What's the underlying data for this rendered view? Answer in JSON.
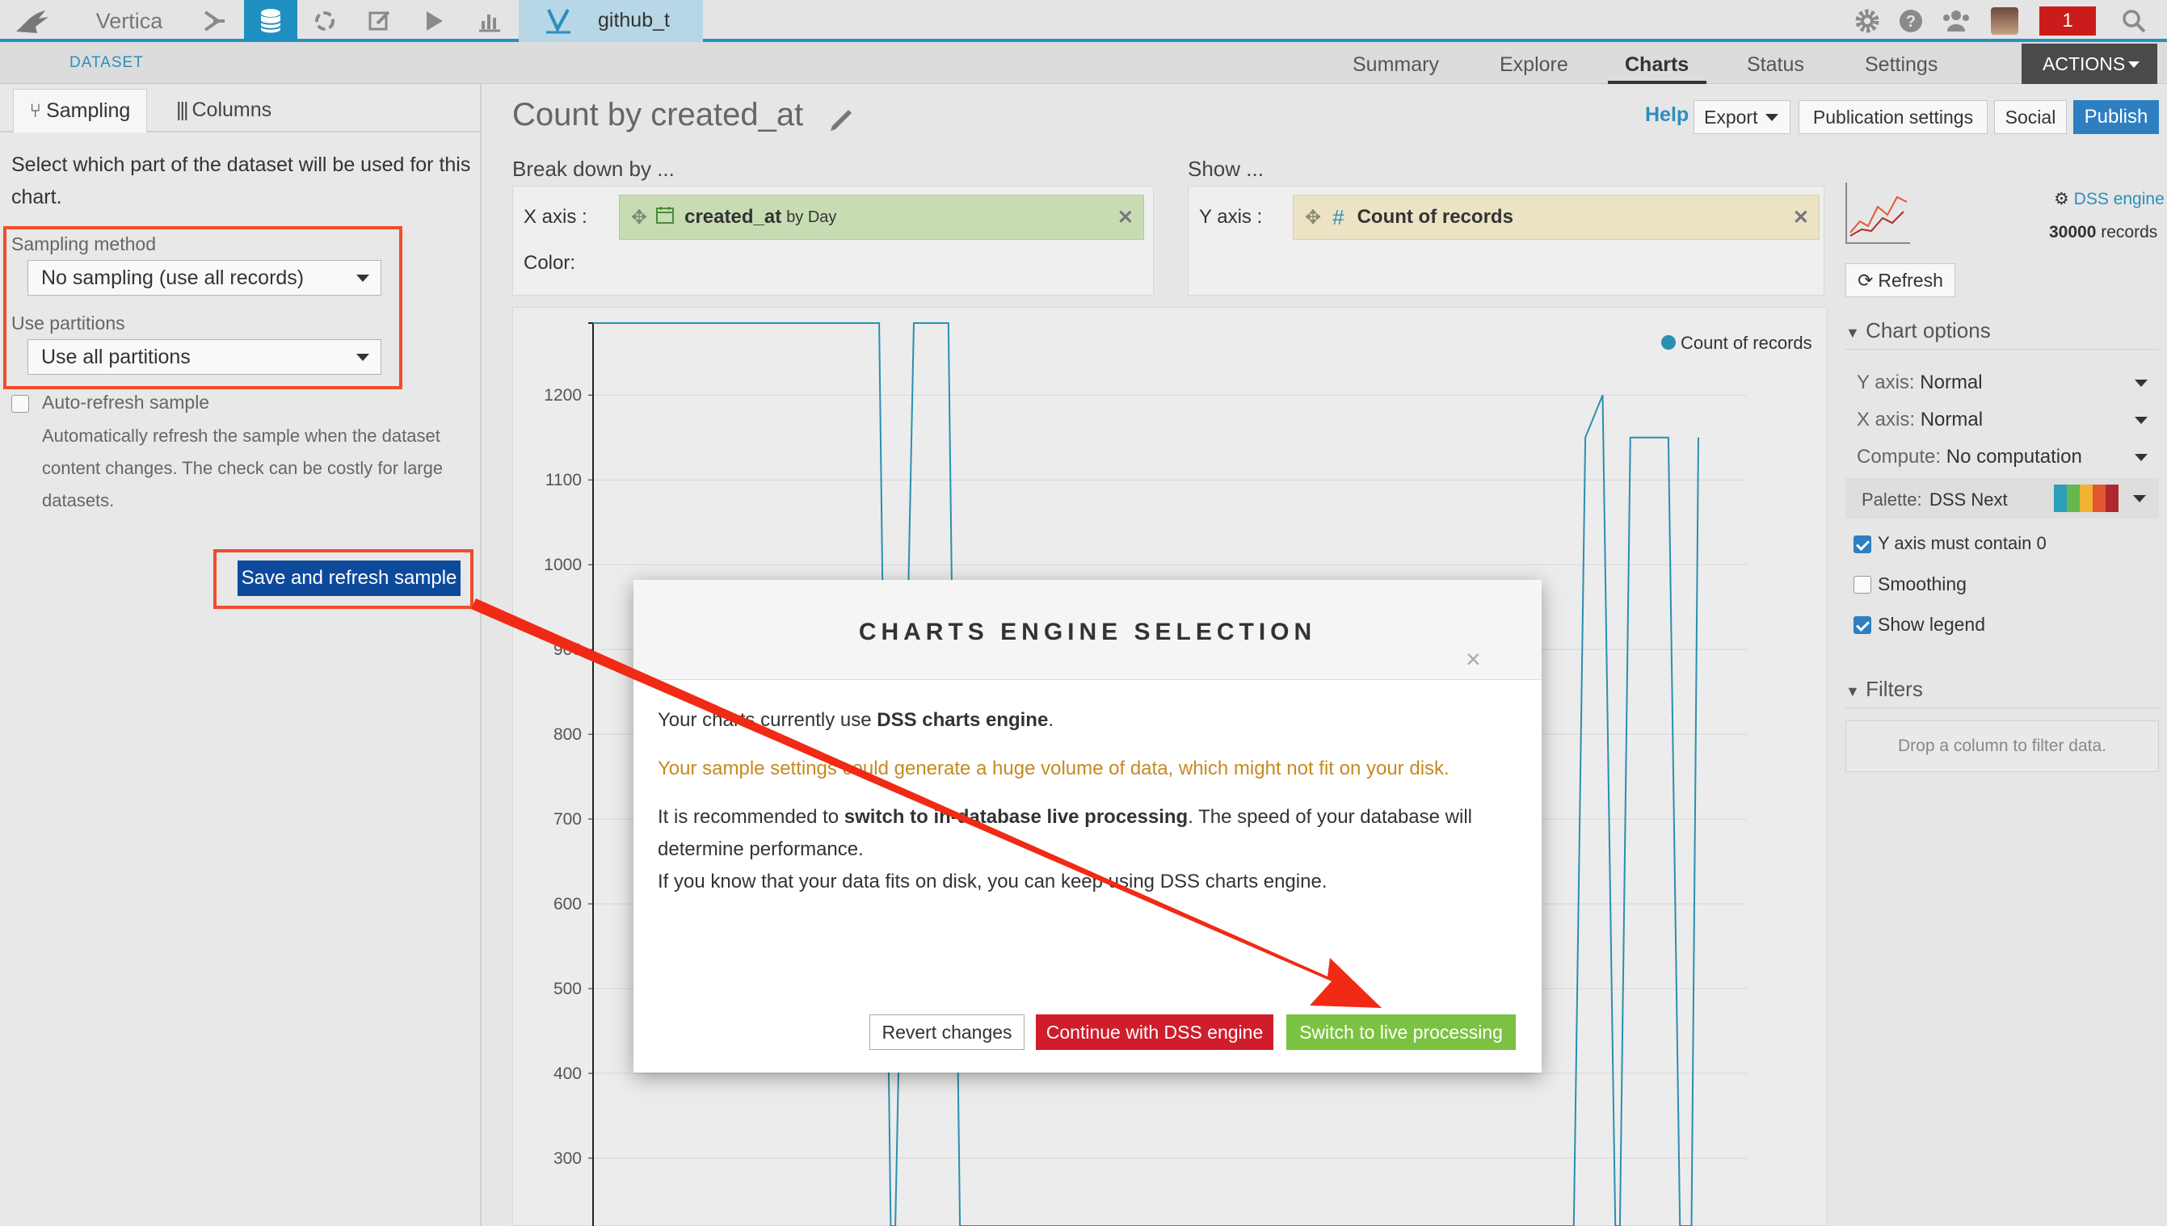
{
  "topbar": {
    "project_name": "Vertica",
    "dataset_name": "github_t",
    "notification_count": "1",
    "colors": {
      "accent": "#2a8fbd",
      "active_tab_bg": "#1f8fc0",
      "dataset_tab_bg": "#b7d6e6",
      "notification": "#cc1b1b"
    }
  },
  "subnav": {
    "section_label": "DATASET",
    "tabs": [
      "Summary",
      "Explore",
      "Charts",
      "Status",
      "Settings"
    ],
    "active_tab": "Charts",
    "actions_label": "ACTIONS"
  },
  "left_panel": {
    "tabs": {
      "sampling": "Sampling",
      "columns": "Columns"
    },
    "intro": "Select which part of the dataset will be used for this chart.",
    "sampling_method_label": "Sampling method",
    "sampling_method_value": "No sampling (use all records)",
    "partitions_label": "Use partitions",
    "partitions_value": "Use all partitions",
    "auto_refresh_label": "Auto-refresh sample",
    "auto_refresh_help": "Automatically refresh the sample when the dataset content changes. The check can be costly for large datasets.",
    "save_button": "Save and refresh sample"
  },
  "chart_header": {
    "title": "Count by created_at",
    "help": "Help",
    "export": "Export",
    "publication_settings": "Publication settings",
    "social": "Social",
    "publish": "Publish"
  },
  "breakdown": {
    "label": "Break down by ...",
    "x_axis_label": "X axis :",
    "x_column": "created_at",
    "x_modifier": "by Day",
    "color_label": "Color:"
  },
  "show": {
    "label": "Show ...",
    "y_axis_label": "Y axis :",
    "y_column": "Count of records"
  },
  "right_panel": {
    "engine": "DSS engine",
    "records": "30000",
    "records_suffix": "records",
    "refresh": "Refresh",
    "chart_options": "Chart options",
    "y_axis": {
      "key": "Y axis:",
      "value": "Normal"
    },
    "x_axis": {
      "key": "X axis:",
      "value": "Normal"
    },
    "compute": {
      "key": "Compute:",
      "value": "No computation"
    },
    "palette": {
      "key": "Palette:",
      "value": "DSS Next"
    },
    "palette_colors": [
      "#2b9fb8",
      "#66b84c",
      "#f2b233",
      "#e4572e",
      "#b0282f"
    ],
    "y_contains_zero": "Y axis must contain 0",
    "smoothing": "Smoothing",
    "show_legend": "Show legend",
    "filters": "Filters",
    "filters_drop": "Drop a column to filter data."
  },
  "chart_data": {
    "type": "line",
    "legend": "Count of records",
    "line_color": "#2b8fb0",
    "y_ticks": [
      "1200",
      "1100",
      "1000",
      "900",
      "800",
      "700",
      "600",
      "500",
      "400",
      "300"
    ],
    "ylim": [
      220,
      1285
    ],
    "series": [
      {
        "name": "Count of records",
        "points": [
          [
            0.0,
            1285
          ],
          [
            0.248,
            1285
          ],
          [
            0.258,
            220
          ],
          [
            0.262,
            220
          ],
          [
            0.278,
            1285
          ],
          [
            0.308,
            1285
          ],
          [
            0.318,
            220
          ],
          [
            0.85,
            220
          ],
          [
            0.86,
            1150
          ],
          [
            0.875,
            1200
          ],
          [
            0.886,
            220
          ],
          [
            0.89,
            220
          ],
          [
            0.899,
            1150
          ],
          [
            0.932,
            1150
          ],
          [
            0.942,
            220
          ],
          [
            0.952,
            220
          ],
          [
            0.958,
            1150
          ]
        ]
      }
    ]
  },
  "modal": {
    "title": "CHARTS ENGINE SELECTION",
    "line1_pre": "Your charts currently use ",
    "line1_bold": "DSS charts engine",
    "line1_post": ".",
    "warning": "Your sample settings could generate a huge volume of data, which might not fit on your disk.",
    "rec_pre": "It is recommended to ",
    "rec_bold": "switch to in-database live processing",
    "rec_post": ". The speed of your database will determine performance.",
    "keep": "If you know that your data fits on disk, you can keep using DSS charts engine.",
    "revert": "Revert changes",
    "continue": "Continue with DSS engine",
    "switch": "Switch to live processing",
    "close": "×"
  }
}
